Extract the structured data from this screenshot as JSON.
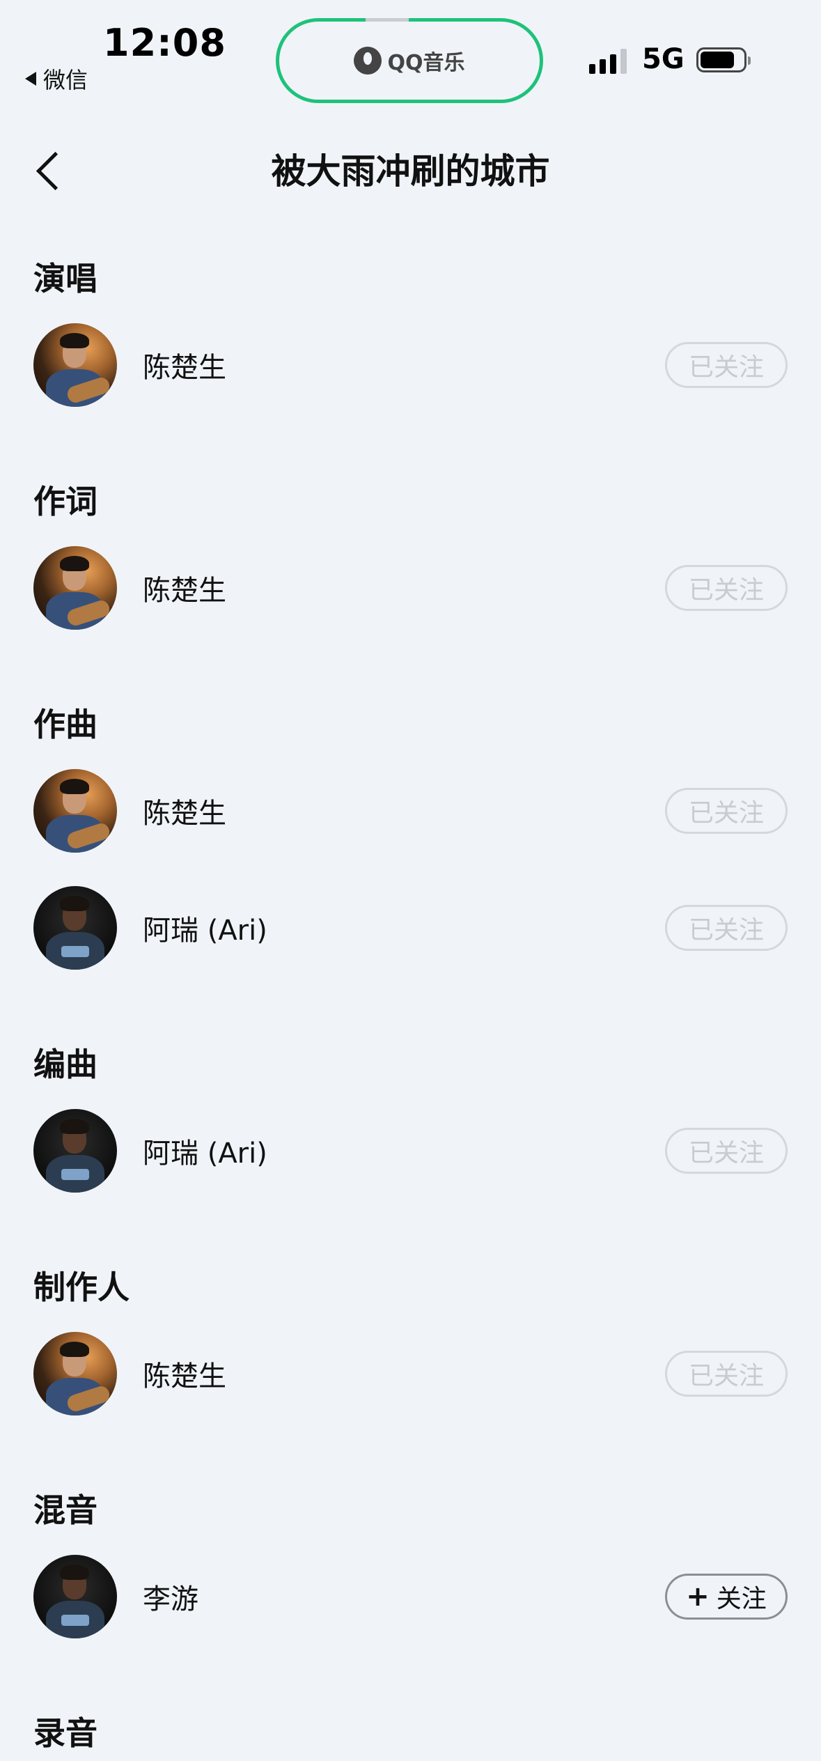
{
  "status_bar": {
    "time": "12:08",
    "back_app": "微信",
    "island_app": "QQ音乐",
    "network": "5G"
  },
  "nav": {
    "title": "被大雨冲刷的城市"
  },
  "sections": [
    {
      "title": "演唱",
      "people": [
        {
          "name": "陈楚生",
          "button": "已关注",
          "following": true
        }
      ]
    },
    {
      "title": "作词",
      "people": [
        {
          "name": "陈楚生",
          "button": "已关注",
          "following": true
        }
      ]
    },
    {
      "title": "作曲",
      "people": [
        {
          "name": "陈楚生",
          "button": "已关注",
          "following": true
        },
        {
          "name": "阿瑞 (Ari)",
          "button": "已关注",
          "following": true
        }
      ]
    },
    {
      "title": "编曲",
      "people": [
        {
          "name": "阿瑞 (Ari)",
          "button": "已关注",
          "following": true
        }
      ]
    },
    {
      "title": "制作人",
      "people": [
        {
          "name": "陈楚生",
          "button": "已关注",
          "following": true
        }
      ]
    },
    {
      "title": "混音",
      "people": [
        {
          "name": "李游",
          "button": "关注",
          "following": false
        }
      ]
    },
    {
      "title": "录音",
      "people": []
    }
  ],
  "colors": {
    "background": "#f0f4f8",
    "accent": "#1ec27a",
    "followed_border": "#d4d8de",
    "followed_text": "#c8ccd2"
  }
}
